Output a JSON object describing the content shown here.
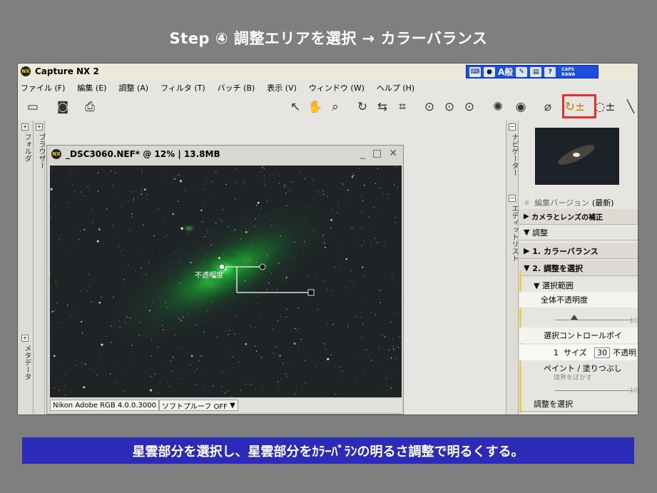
{
  "slide": {
    "title": "Step ④ 調整エリアを選択 → カラーバランス",
    "caption": "星雲部分を選択し、星雲部分をｶﾗｰﾊﾞﾗﾝの明るさ調整で明るくする。"
  },
  "app": {
    "title": "Capture NX 2",
    "logo_text": "NX",
    "ime": {
      "text": "A般",
      "caps": "CAPS",
      "kana": "KANA"
    },
    "menu": [
      "ファイル (F)",
      "編集 (E)",
      "調整 (A)",
      "フィルタ (T)",
      "バッチ (B)",
      "表示 (V)",
      "ウィンドウ (W)",
      "ヘルプ (H)"
    ],
    "left_panels": {
      "folder": "フォルダ",
      "browser": "ブラウザー",
      "metadata": "メタデータ"
    },
    "right_panels": {
      "navigator": "ナビゲーター",
      "edit_list": "エディットリスト"
    }
  },
  "image_window": {
    "title": "_DSC3060.NEF* @ 12% | 13.8MB",
    "control_point_label": "不透明度",
    "status_profile": "Nikon Adobe RGB 4.0.0.3000",
    "status_softproof": "ソフトプルーフ OFF"
  },
  "edit_list": {
    "version_label": "編集バージョン",
    "version_value": "(最新)",
    "camera_lens": "カメラとレンズの補正",
    "adjust": "調整",
    "step1": "1. カラーバランス",
    "step2": "2. 調整を選択",
    "selection_range": "選択範囲",
    "overall_opacity": "全体不透明度",
    "slider_max": "10",
    "control_point": "選択コントロールポイ",
    "cp_index": "1",
    "size_label": "サイズ",
    "size_value": "30",
    "opacity_short": "不透明",
    "paint_label": "ペイント / 塗りつぶし",
    "border_label": "境界をぼかす",
    "select_adjust": "調整を選択"
  },
  "colors": {
    "background": "#7f7f7f",
    "caption_bg": "#2b2bb8",
    "highlight": "#e8302a",
    "nebula": "#1ec83c"
  }
}
